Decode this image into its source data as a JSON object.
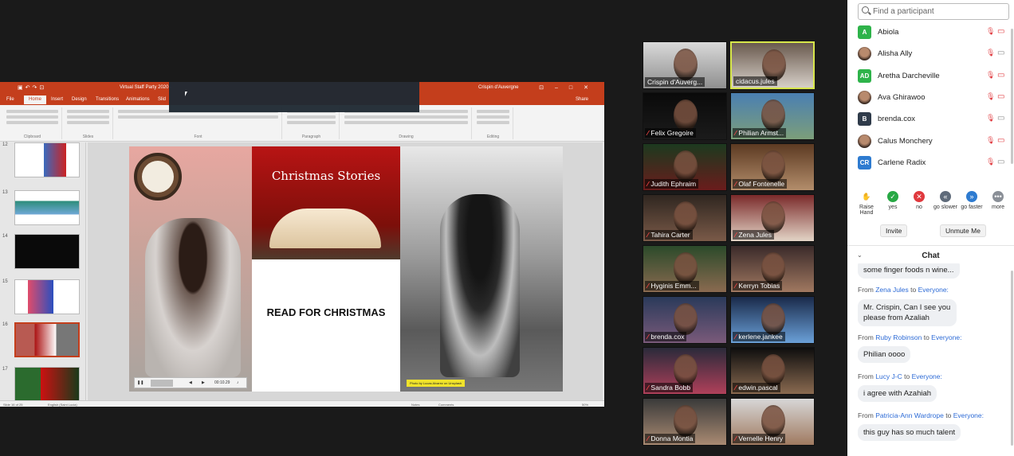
{
  "ppt": {
    "file_title": "Virtual Staff Party 2020 -",
    "user_name": "Crispin d'Auvergne",
    "tabs": [
      "File",
      "Home",
      "Insert",
      "Design",
      "Transitions",
      "Animations",
      "Slid"
    ],
    "tell_me": "Share",
    "ribbon_groups": [
      "Clipboard",
      "Slides",
      "Font",
      "Paragraph",
      "Drawing",
      "Editing"
    ],
    "thumb_numbers": [
      "12",
      "13",
      "14",
      "15",
      "16",
      "17"
    ],
    "status_left": "Slide 16 of 25",
    "status_lang": "English (Saint Lucia)",
    "status_notes": "Notes",
    "status_comments": "Comments",
    "zoom": "50%"
  },
  "slide": {
    "title": "Christmas Stories",
    "body": "READ FOR CHRISTMAS",
    "credit": "Photo by Lucas Alvarez on Unsplash",
    "video_time": "00:10.29"
  },
  "video_tiles": [
    {
      "name": "Crispin d'Auverg...",
      "muted": false
    },
    {
      "name": "cidacus.jules",
      "muted": false
    },
    {
      "name": "Felix Gregoire",
      "muted": true
    },
    {
      "name": "Philian Armst...",
      "muted": true
    },
    {
      "name": "Judith Ephraim",
      "muted": true
    },
    {
      "name": "Olaf Fontenelle",
      "muted": true
    },
    {
      "name": "Tahira Carter",
      "muted": true
    },
    {
      "name": "Zena Jules",
      "muted": true
    },
    {
      "name": "Hyginis Emm...",
      "muted": true
    },
    {
      "name": "Kerryn Tobias",
      "muted": true
    },
    {
      "name": "brenda.cox",
      "muted": true
    },
    {
      "name": "kerlene.jankee",
      "muted": true
    },
    {
      "name": "Sandra Bobb",
      "muted": true
    },
    {
      "name": "edwin.pascal",
      "muted": true
    },
    {
      "name": "Donna Montia",
      "muted": true
    },
    {
      "name": "Vernelle Henry",
      "muted": true
    }
  ],
  "participants": {
    "search_placeholder": "Find a participant",
    "list": [
      {
        "initials": "A",
        "name": "Abiola",
        "color": "#2eb34a",
        "photo": false,
        "cam": "off"
      },
      {
        "initials": "",
        "name": "Alisha Ally",
        "color": "#8a5a44",
        "photo": true,
        "cam": "on"
      },
      {
        "initials": "AD",
        "name": "Aretha Darcheville",
        "color": "#2eb34a",
        "photo": false,
        "cam": "off"
      },
      {
        "initials": "",
        "name": "Ava Ghirawoo",
        "color": "#8a5a44",
        "photo": true,
        "cam": "off"
      },
      {
        "initials": "B",
        "name": "brenda.cox",
        "color": "#2f3b4a",
        "photo": false,
        "cam": "on"
      },
      {
        "initials": "",
        "name": "Calus Monchery",
        "color": "#8a5a44",
        "photo": true,
        "cam": "off"
      },
      {
        "initials": "CR",
        "name": "Carlene Radix",
        "color": "#2e7bd0",
        "photo": false,
        "cam": "on"
      }
    ]
  },
  "reactions": [
    {
      "label": "Raise Hand",
      "glyph": "✋",
      "color": "#ffffff"
    },
    {
      "label": "yes",
      "glyph": "✓",
      "color": "#27a844"
    },
    {
      "label": "no",
      "glyph": "✕",
      "color": "#e0393e"
    },
    {
      "label": "go slower",
      "glyph": "«",
      "color": "#5f6b7a"
    },
    {
      "label": "go faster",
      "glyph": "»",
      "color": "#2e7bd0"
    },
    {
      "label": "more",
      "glyph": "•••",
      "color": "#8a8f97"
    }
  ],
  "buttons": {
    "invite": "Invite",
    "unmute": "Unmute Me"
  },
  "chat": {
    "title": "Chat",
    "to_word": "to",
    "messages": [
      {
        "from": "",
        "to": "",
        "text": "some finger foods n wine..."
      },
      {
        "from": "Zena Jules",
        "to": "Everyone:",
        "text": "Mr. Crispin, Can I see you please from Azaliah"
      },
      {
        "from": "Ruby Robinson",
        "to": "Everyone:",
        "text": "Philian oooo"
      },
      {
        "from": "Lucy J-C",
        "to": "Everyone:",
        "text": "i agree with Azahiah"
      },
      {
        "from": "Patricia-Ann Wardrope",
        "to": "Everyone:",
        "text": "this guy has so much talent"
      }
    ]
  }
}
